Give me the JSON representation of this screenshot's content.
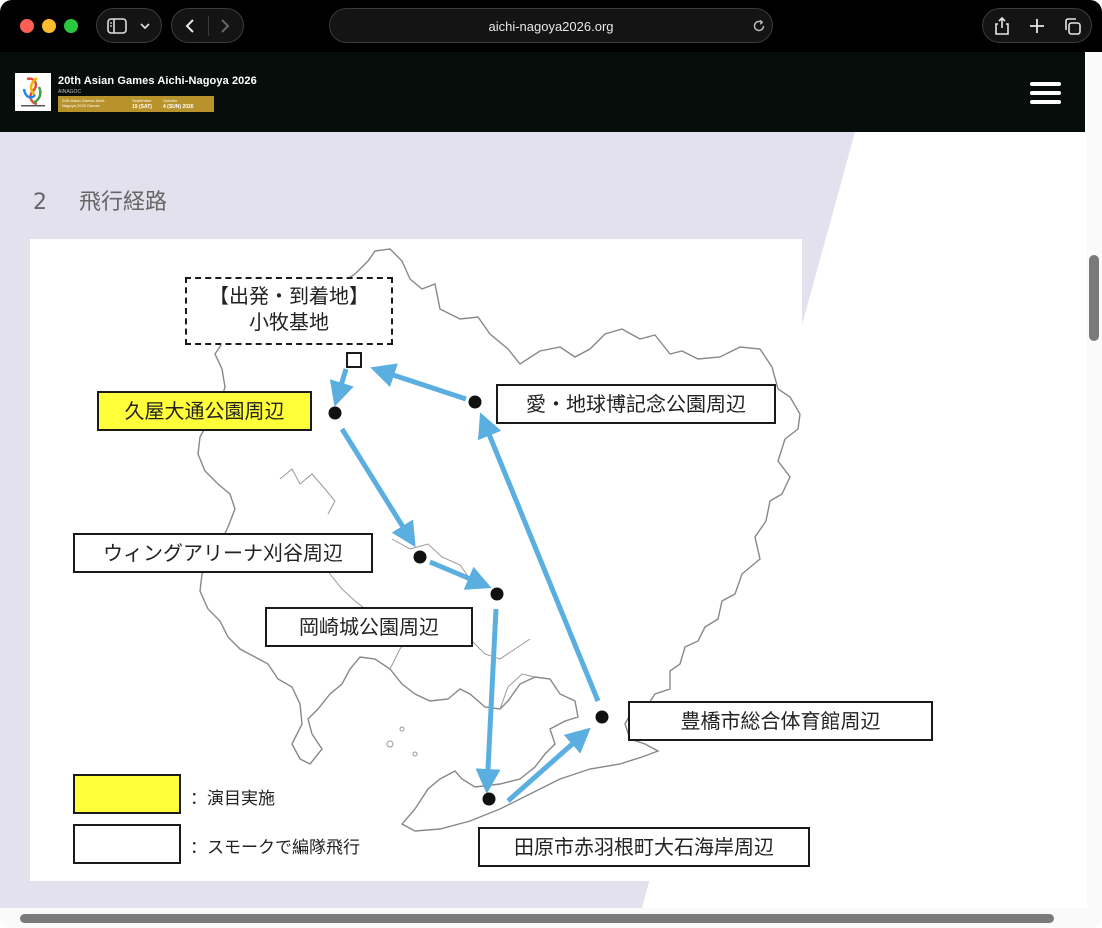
{
  "browser": {
    "url": "aichi-nagoya2026.org",
    "traffic_lights": [
      "close",
      "minimize",
      "zoom"
    ],
    "toolbar_icons": [
      "sidebar-icon",
      "chevron-down-icon",
      "back-icon",
      "forward-icon",
      "reload-icon",
      "share-icon",
      "new-tab-icon",
      "tab-overview-icon"
    ]
  },
  "site_header": {
    "title": "20th Asian Games Aichi-Nagoya 2026",
    "subtitle": "AINAGOC",
    "band_left": "20th Asian Games Aichi-Nagoya 2026 Games",
    "band_mid_label": "September",
    "band_mid_value": "19 (SAT)",
    "band_right_label": "October",
    "band_right_value": "4 (SUN) 2026",
    "menu_icon": "hamburger-icon"
  },
  "section": {
    "number": "2",
    "title": "飛行経路"
  },
  "map": {
    "base_label_line1": "【出発・到着地】",
    "base_label_line2": "小牧基地",
    "locations": [
      {
        "name": "久屋大通公園周辺",
        "type": "performance"
      },
      {
        "name": "愛・地球博記念公園周辺",
        "type": "formation"
      },
      {
        "name": "ウィングアリーナ刈谷周辺",
        "type": "formation"
      },
      {
        "name": "岡崎城公園周辺",
        "type": "formation"
      },
      {
        "name": "豊橋市総合体育館周辺",
        "type": "formation"
      },
      {
        "name": "田原市赤羽根町大石海岸周辺",
        "type": "formation"
      }
    ],
    "legend": [
      {
        "label": "：演目実施",
        "color": "#ffff3a"
      },
      {
        "label": "：スモークで編隊飛行",
        "color": "#ffffff"
      }
    ],
    "colors": {
      "route": "#5aaee0",
      "highlight": "#ffff3a",
      "background_band": "#e3e1ee"
    }
  }
}
